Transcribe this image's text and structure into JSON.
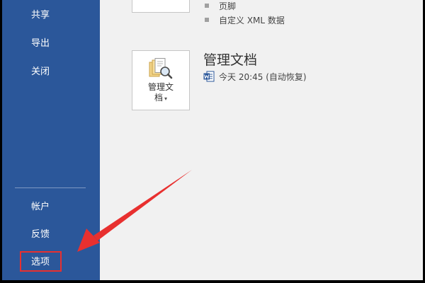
{
  "sidebar": {
    "items": [
      {
        "id": "share",
        "label": "共享"
      },
      {
        "id": "export",
        "label": "导出"
      },
      {
        "id": "close",
        "label": "关闭"
      },
      {
        "id": "account",
        "label": "帐户"
      },
      {
        "id": "feedback",
        "label": "反馈"
      },
      {
        "id": "options",
        "label": "选项"
      }
    ],
    "highlighted_item": "options"
  },
  "main": {
    "property_list": [
      {
        "label": "页脚"
      },
      {
        "label": "自定义 XML 数据"
      }
    ],
    "manage_document": {
      "button_label_line1": "管理文",
      "button_label_line2": "档",
      "button_icon": "manage-document-icon",
      "title": "管理文档",
      "versions": [
        {
          "icon": "word-file-icon",
          "text": "今天 20:45 (自动恢复)"
        }
      ]
    }
  },
  "annotation": {
    "arrow_color": "#e8302f",
    "box_color": "#e8302f",
    "target": "options"
  },
  "colors": {
    "sidebar_background": "#2b579a",
    "main_background": "#f1f1f1",
    "word_blue": "#2b579a",
    "annotation_red": "#e8302f"
  }
}
